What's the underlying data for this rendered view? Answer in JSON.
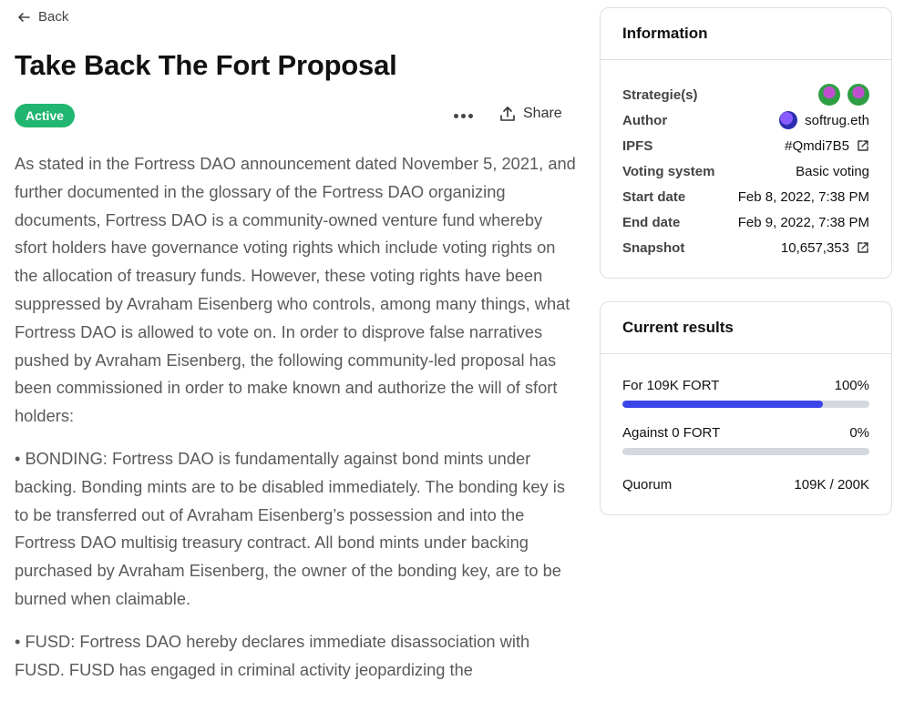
{
  "nav": {
    "back_label": "Back"
  },
  "proposal": {
    "title": "Take Back The Fort Proposal",
    "status": "Active",
    "share_label": "Share",
    "body": [
      "As stated in the Fortress DAO announcement dated November 5, 2021, and further documented in the glossary of the Fortress DAO organizing documents, Fortress DAO is a community-owned venture fund whereby sfort holders have governance voting rights which include voting rights on the allocation of treasury funds. However, these voting rights have been suppressed by Avraham Eisenberg who controls, among many things, what Fortress DAO is allowed to vote on. In order to disprove false narratives pushed by Avraham Eisenberg, the following community-led proposal has been commissioned in order to make known and authorize the will of sfort holders:",
      "• BONDING: Fortress DAO is fundamentally against bond mints under backing. Bonding mints are to be disabled immediately. The bonding key is to be transferred out of Avraham Eisenberg’s possession and into the Fortress DAO multisig treasury contract. All bond mints under backing purchased by Avraham Eisenberg, the owner of the bonding key, are to be burned when claimable.",
      "• FUSD: Fortress DAO hereby declares immediate disassociation with FUSD. FUSD has engaged in criminal activity jeopardizing the"
    ]
  },
  "information": {
    "heading": "Information",
    "rows": [
      {
        "key": "Strategie(s)",
        "value": ""
      },
      {
        "key": "Author",
        "value": "softrug.eth"
      },
      {
        "key": "IPFS",
        "value": "#Qmdi7B5"
      },
      {
        "key": "Voting system",
        "value": "Basic voting"
      },
      {
        "key": "Start date",
        "value": "Feb 8, 2022, 7:38 PM"
      },
      {
        "key": "End date",
        "value": "Feb 9, 2022, 7:38 PM"
      },
      {
        "key": "Snapshot",
        "value": "10,657,353"
      }
    ]
  },
  "results": {
    "heading": "Current results",
    "choices": [
      {
        "label": "For 109K FORT",
        "percent_label": "100%",
        "fill_fraction": 0.81
      },
      {
        "label": "Against 0 FORT",
        "percent_label": "0%",
        "fill_fraction": 0
      }
    ],
    "quorum_label": "Quorum",
    "quorum_value": "109K / 200K"
  },
  "colors": {
    "active_badge": "#21b66f",
    "bar_fill": "#3b45e8",
    "bar_track": "#d4d8e0"
  }
}
